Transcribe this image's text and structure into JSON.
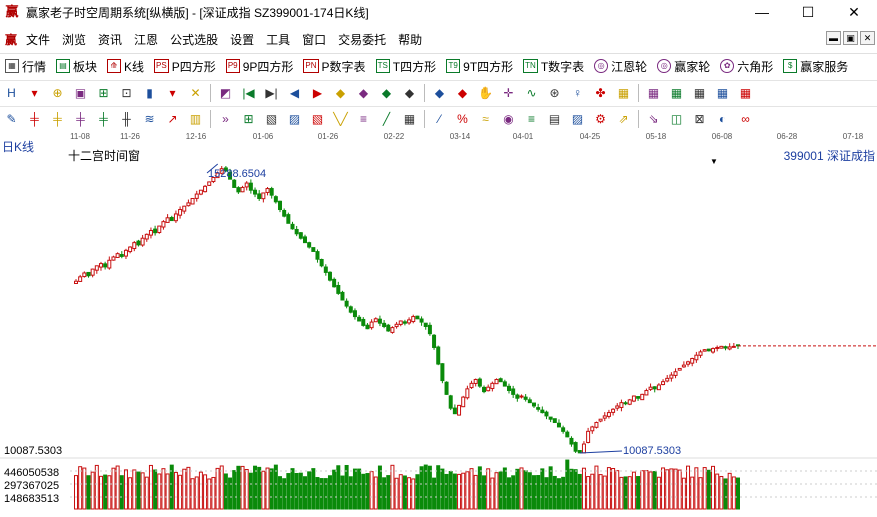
{
  "window": {
    "title": "赢家老子时空周期系统[纵横版] - [深证成指  SZ399001-174日K线]",
    "controls": {
      "minimize": "—",
      "maximize": "☐",
      "close": "✕"
    }
  },
  "menu": {
    "items": [
      "文件",
      "浏览",
      "资讯",
      "江恩",
      "公式选股",
      "设置",
      "工具",
      "窗口",
      "交易委托",
      "帮助"
    ],
    "mdi_controls": [
      "▬",
      "▣",
      "✕"
    ]
  },
  "toolbar1": {
    "items": [
      {
        "icon": "▦",
        "label": "行情"
      },
      {
        "icon": "▤",
        "label": "板块"
      },
      {
        "icon": "⟰",
        "label": "K线"
      },
      {
        "icon": "PS",
        "label": "P四方形"
      },
      {
        "icon": "P9",
        "label": "9P四方形"
      },
      {
        "icon": "PN",
        "label": "P数字表"
      },
      {
        "icon": "TS",
        "label": "T四方形"
      },
      {
        "icon": "T9",
        "label": "9T四方形"
      },
      {
        "icon": "TN",
        "label": "T数字表"
      },
      {
        "icon": "◎",
        "label": "江恩轮"
      },
      {
        "icon": "◎",
        "label": "赢家轮"
      },
      {
        "icon": "✿",
        "label": "六角形"
      },
      {
        "icon": "$",
        "label": "赢家服务"
      }
    ]
  },
  "toolbar2": {
    "icons": [
      "H",
      "▾",
      "⊕",
      "▣",
      "⊞",
      "⊡",
      "▮",
      "▾",
      "✕",
      "◩",
      "|◀",
      "▶|",
      "◀",
      "▶",
      "◆",
      "◆",
      "◆",
      "◆",
      "◆",
      "◆",
      "✋",
      "✛",
      "∿",
      "⊛",
      "♀",
      "✤",
      "▦",
      "▦",
      "▦",
      "▦",
      "▦",
      "▦"
    ]
  },
  "toolbar3": {
    "icons": [
      "✎",
      "╪",
      "╪",
      "╪",
      "╪",
      "╫",
      "≋",
      "↗",
      "▥",
      "»",
      "⊞",
      "▧",
      "▨",
      "▧",
      "╲╱",
      "≡",
      "╱",
      "▦",
      "⁄",
      "%",
      "≈",
      "◉",
      "≡",
      "▤",
      "▨",
      "⚙",
      "⇗",
      "⇘",
      "◫",
      "⊠",
      "◐",
      "∞"
    ]
  },
  "chart": {
    "period_label": "日K线",
    "window_label": "十二宫时间窗",
    "code_label": "399001  深证成指",
    "date_ticks": [
      "11-08",
      "11-26",
      "12-16",
      "01-06",
      "01-26",
      "02-22",
      "03-14",
      "04-01",
      "04-25",
      "05-18",
      "06-08",
      "06-28",
      "07-18"
    ],
    "high_annotation": "15288.6504",
    "low_annotation": "10087.5303",
    "price_axis_low": "10087.5303",
    "volume_axis": [
      "446050538",
      "297367025",
      "148683513"
    ],
    "colors": {
      "up": "#c81010",
      "down": "#0a8a0a",
      "annotation": "#1d3fa0",
      "last_price_line": "#c81010"
    }
  },
  "chart_data": {
    "type": "candlestick",
    "title": "",
    "series_name": "",
    "high_marker": 15288.6504,
    "low_marker": 10087.5303,
    "ohlc_close": [
      13200,
      13280,
      13350,
      13300,
      13420,
      13480,
      13520,
      13460,
      13580,
      13640,
      13700,
      13650,
      13760,
      13820,
      13900,
      13860,
      13980,
      14050,
      14120,
      14080,
      14200,
      14280,
      14350,
      14300,
      14420,
      14500,
      14560,
      14620,
      14700,
      14780,
      14850,
      14920,
      15000,
      15080,
      15160,
      15240,
      15200,
      15050,
      14900,
      14820,
      14900,
      14980,
      14850,
      14780,
      14700,
      14800,
      14880,
      14760,
      14640,
      14500,
      14380,
      14250,
      14150,
      14060,
      13980,
      13900,
      13820,
      13740,
      13600,
      13480,
      13360,
      13220,
      13100,
      12980,
      12860,
      12750,
      12640,
      12560,
      12480,
      12400,
      12340,
      12460,
      12520,
      12440,
      12380,
      12300,
      12360,
      12420,
      12480,
      12440,
      12500,
      12560,
      12520,
      12460,
      12380,
      12250,
      12000,
      11700,
      11400,
      11150,
      10900,
      10800,
      10950,
      11100,
      11250,
      11350,
      11420,
      11300,
      11200,
      11280,
      11350,
      11420,
      11380,
      11300,
      11220,
      11150,
      11080,
      11120,
      11060,
      11000,
      10940,
      10880,
      10820,
      10760,
      10700,
      10640,
      10560,
      10480,
      10380,
      10250,
      10120,
      10090,
      10250,
      10480,
      10560,
      10640,
      10700,
      10760,
      10820,
      10880,
      10940,
      11000,
      10980,
      11050,
      11120,
      11080,
      11150,
      11220,
      11280,
      11250,
      11320,
      11380,
      11440,
      11500,
      11560,
      11620,
      11680,
      11740,
      11800,
      11860,
      11920,
      11960,
      11940,
      11980,
      12000,
      12020,
      11990,
      12010,
      12020,
      12030
    ]
  }
}
